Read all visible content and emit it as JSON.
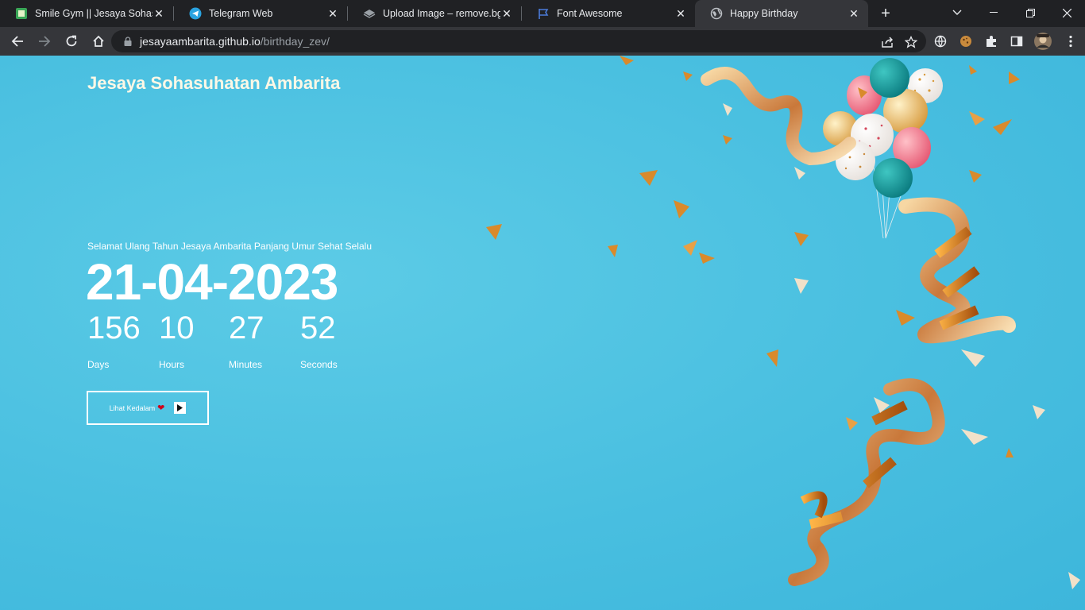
{
  "browser": {
    "tabs": [
      {
        "title": "Smile Gym || Jesaya Sohasuhatan",
        "icon": "gym-icon"
      },
      {
        "title": "Telegram Web",
        "icon": "telegram-icon"
      },
      {
        "title": "Upload Image – remove.bg",
        "icon": "layers-icon"
      },
      {
        "title": "Font Awesome",
        "icon": "flag-icon"
      },
      {
        "title": "Happy Birthday",
        "icon": "globe-icon"
      }
    ],
    "active_tab": 4,
    "url_host": "jesayaambarita.github.io",
    "url_path": "/birthday_zev/"
  },
  "page": {
    "brand": "Jesaya Sohasuhatan Ambarita",
    "greeting": "Selamat Ulang Tahun Jesaya Ambarita Panjang Umur Sehat Selalu",
    "date": "21-04-2023",
    "countdown": [
      {
        "value": "156",
        "label": "Days"
      },
      {
        "value": "10",
        "label": "Hours"
      },
      {
        "value": "27",
        "label": "Minutes"
      },
      {
        "value": "52",
        "label": "Seconds"
      }
    ],
    "cta_label": "Lihat Kedalam",
    "colors": {
      "background": "#49bfe0",
      "text": "#ffffff",
      "heart": "#d0021b"
    }
  }
}
